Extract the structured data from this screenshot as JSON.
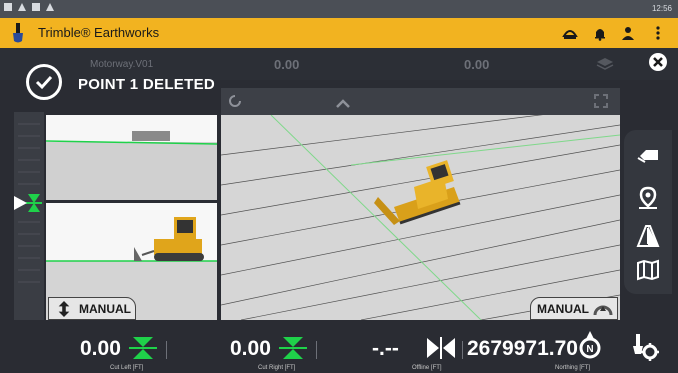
{
  "status_bar": {
    "time": "12:56"
  },
  "app_bar": {
    "title": "Trimble® Earthworks",
    "icons": [
      "shovel-logo-icon",
      "sensor-icon",
      "bell-icon",
      "operator-icon",
      "more-vert-icon"
    ],
    "brand_color": "#f2b320"
  },
  "top_strip": {
    "design_name": "Motorway.V01",
    "value_left": "0.00",
    "value_right": "0.00"
  },
  "notification": {
    "message": "POINT 1 DELETED"
  },
  "views": {
    "side_label": "MANUAL",
    "plan_label": "MANUAL"
  },
  "right_toolbar": {
    "icons": [
      "blade-icon",
      "location-icon",
      "road-icon",
      "map-icon"
    ]
  },
  "bottom_bar": {
    "cut_left_value": "0.00",
    "cut_left_label": "Cut Left [FT]",
    "cut_right_value": "0.00",
    "cut_right_label": "Cut Right [FT]",
    "offline_value": "-.--",
    "offline_label": "Offline [FT]",
    "northing_value": "2679971.70",
    "northing_label": "Northing [FT]",
    "accent_color": "#1fd24a"
  }
}
